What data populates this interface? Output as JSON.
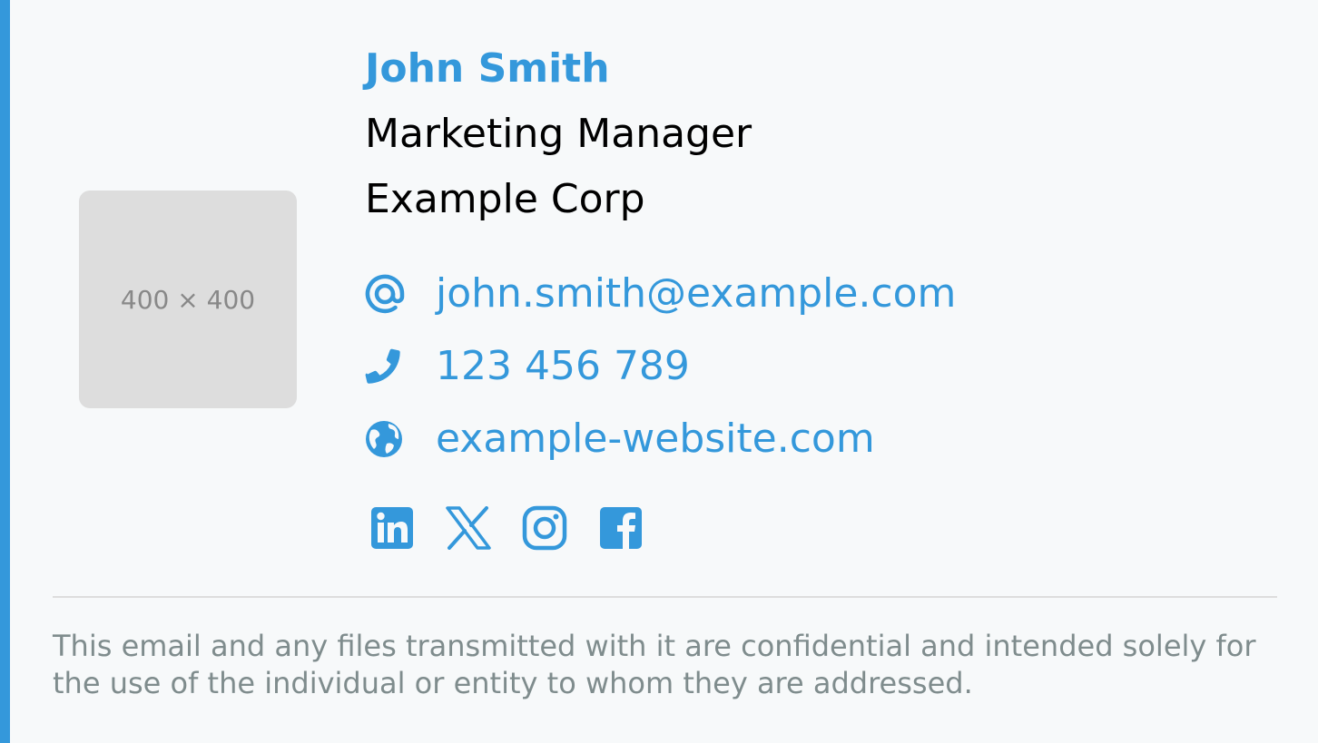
{
  "photo": {
    "placeholder_text": "400 × 400"
  },
  "person": {
    "name": "John Smith",
    "job_title": "Marketing Manager",
    "company": "Example Corp"
  },
  "contacts": {
    "email": "john.smith@example.com",
    "phone": "123 456 789",
    "website": "example-website.com"
  },
  "icons": {
    "email": "at-icon",
    "phone": "phone-icon",
    "website": "globe-icon",
    "social": [
      "linkedin-icon",
      "x-icon",
      "instagram-icon",
      "facebook-icon"
    ]
  },
  "disclaimer": "This email and any files transmitted with it are confidential and intended solely for the use of the individual or entity to whom they are addressed.",
  "colors": {
    "accent": "#3498db",
    "muted_text": "#7f8c8d",
    "background": "#f7f9fa",
    "placeholder_bg": "#dddddd"
  }
}
